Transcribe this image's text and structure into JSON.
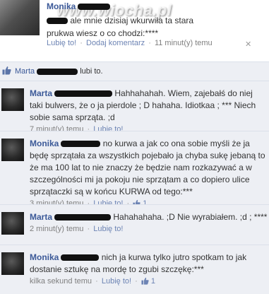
{
  "post": {
    "author": "Monika",
    "text_line1": "ale mnie dzisiaj wkurwiła ta stara",
    "text_line2": "prukwa wiesz o co chodzi:****",
    "like_link": "Lubię to!",
    "comment_link": "Dodaj komentarz",
    "time": "11 minut(y) temu",
    "watermark": "www.wiocha.pl"
  },
  "likes": {
    "who": "Marta",
    "suffix": "lubi to."
  },
  "comments": [
    {
      "author": "Marta",
      "text": "Hahhahahah. Wiem, zajebałś do niej taki bulwers, że o ja pierdole ; D hahaha. Idiotkaa ; *** Niech sobie sama sprząta. ;d",
      "time": "7 minut(y) temu",
      "like_link": "Lubię to!",
      "like_count": ""
    },
    {
      "author": "Monika",
      "text": "no kurwa a jak co ona sobie myśli że ja będę sprzątała za wszystkich pojebało ja chyba sukę jebaną to że ma 100 lat to nie znaczy że będzie nam rozkazywać a w szczególności mi ja pokoju nie sprzątam a co dopiero ulice sprzątaczki są w końcu KURWA od tego:***",
      "time": "3 minut(y) temu",
      "like_link": "Lubię to!",
      "like_count": "1"
    },
    {
      "author": "Marta",
      "text": "Hahahahaha. ;D Nie wyrabiałem. ;d ; ****",
      "time": "2 minut(y) temu",
      "like_link": "Lubię to!",
      "like_count": ""
    },
    {
      "author": "Monika",
      "text": "nich ja kurwa tylko jutro spotkam to jak dostanie sztukę na mordę to zgubi szczękę:***",
      "time": "kilka sekund temu",
      "like_link": "Lubię to!",
      "like_count": "1"
    }
  ]
}
